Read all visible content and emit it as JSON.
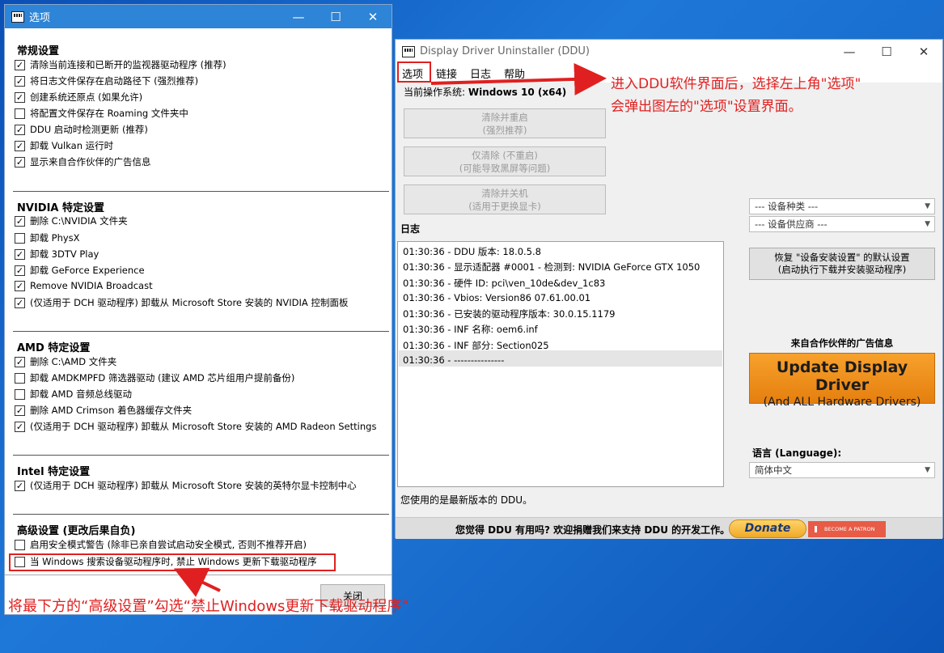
{
  "options_window": {
    "title": "选项",
    "sections": [
      {
        "heading": "常规设置",
        "items": [
          {
            "label": "清除当前连接和已断开的监视器驱动程序 (推荐)",
            "checked": true
          },
          {
            "label": "将日志文件保存在启动路径下 (强烈推荐)",
            "checked": true
          },
          {
            "label": "创建系统还原点 (如果允许)",
            "checked": true
          },
          {
            "label": "将配置文件保存在 Roaming 文件夹中",
            "checked": false
          },
          {
            "label": "DDU 启动时检测更新 (推荐)",
            "checked": true
          },
          {
            "label": "卸载 Vulkan 运行时",
            "checked": true
          },
          {
            "label": "显示来自合作伙伴的广告信息",
            "checked": true
          }
        ]
      },
      {
        "heading": "NVIDIA 特定设置",
        "items": [
          {
            "label": "删除 C:\\NVIDIA 文件夹",
            "checked": true
          },
          {
            "label": "卸载 PhysX",
            "checked": false
          },
          {
            "label": "卸载 3DTV Play",
            "checked": true
          },
          {
            "label": "卸载 GeForce Experience",
            "checked": true
          },
          {
            "label": "Remove NVIDIA Broadcast",
            "checked": true
          },
          {
            "label": "(仅适用于 DCH 驱动程序) 卸载从 Microsoft Store 安装的 NVIDIA 控制面板",
            "checked": true
          }
        ]
      },
      {
        "heading": "AMD 特定设置",
        "items": [
          {
            "label": "删除 C:\\AMD 文件夹",
            "checked": true
          },
          {
            "label": "卸载 AMDKMPFD 筛选器驱动 (建议 AMD 芯片组用户提前备份)",
            "checked": false
          },
          {
            "label": "卸载 AMD 音频总线驱动",
            "checked": false
          },
          {
            "label": "删除 AMD Crimson 着色器缓存文件夹",
            "checked": true
          },
          {
            "label": "(仅适用于 DCH 驱动程序) 卸载从 Microsoft Store 安装的 AMD Radeon Settings",
            "checked": true
          }
        ]
      },
      {
        "heading": "Intel 特定设置",
        "items": [
          {
            "label": "(仅适用于 DCH 驱动程序) 卸载从 Microsoft Store 安装的英特尔显卡控制中心",
            "checked": true
          }
        ]
      },
      {
        "heading": "高级设置 (更改后果自负)",
        "items": [
          {
            "label": "启用安全模式警告 (除非已亲自尝试启动安全模式, 否则不推荐开启)",
            "checked": false
          },
          {
            "label": "当 Windows 搜索设备驱动程序时, 禁止 Windows 更新下载驱动程序",
            "checked": false
          }
        ]
      }
    ],
    "close_label": "关闭"
  },
  "ddu_window": {
    "title": "Display Driver Uninstaller (DDU)",
    "menu": [
      "选项",
      "链接",
      "日志",
      "帮助"
    ],
    "os_prefix": "当前操作系统: ",
    "os_value": "Windows 10 (x64)",
    "buttons": [
      {
        "line1": "清除并重启",
        "line2": "(强烈推荐)"
      },
      {
        "line1": "仅清除 (不重启)",
        "line2": "(可能导致黑屏等问题)"
      },
      {
        "line1": "清除并关机",
        "line2": "(适用于更换显卡)"
      }
    ],
    "log_label": "日志",
    "log_lines": [
      "01:30:36 - DDU 版本: 18.0.5.8",
      "01:30:36 - 显示适配器 #0001 - 检测到: NVIDIA GeForce GTX 1050",
      "01:30:36 - 硬件 ID: pci\\ven_10de&dev_1c83",
      "01:30:36 - Vbios: Version86 07.61.00.01",
      "01:30:36 - 已安装的驱动程序版本: 30.0.15.1179",
      "01:30:36 - INF 名称: oem6.inf",
      "01:30:36 - INF 部分: Section025",
      "01:30:36 - ---------------"
    ],
    "status_text": "您使用的是最新版本的 DDU。",
    "device_type": "--- 设备种类 ---",
    "device_vendor": "--- 设备供应商 ---",
    "restore_line1": "恢复 \"设备安装设置\" 的默认设置",
    "restore_line2": "(启动执行下载并安装驱动程序)",
    "ad_label": "来自合作伙伴的广告信息",
    "ad_line1": "Update Display Driver",
    "ad_line2": "(And ALL Hardware Drivers)",
    "language_label": "语言 (Language):",
    "language_value": "简体中文",
    "footer_msg": "您觉得 DDU 有用吗? 欢迎捐赠我们来支持 DDU 的开发工作。",
    "donate_label": "Donate",
    "patron_label": "BECOME A PATRON"
  },
  "annotations": {
    "top_line1": "进入DDU软件界面后，选择左上角\"选项\"",
    "top_line2": "会弹出图左的\"选项\"设置界面。",
    "bottom": "将最下方的“高级设置”勾选“禁止Windows更新下载驱动程序”"
  },
  "colors": {
    "annotation_red": "#e02020",
    "title_blue": "#2e84d6",
    "ad_orange": "#f29322"
  }
}
